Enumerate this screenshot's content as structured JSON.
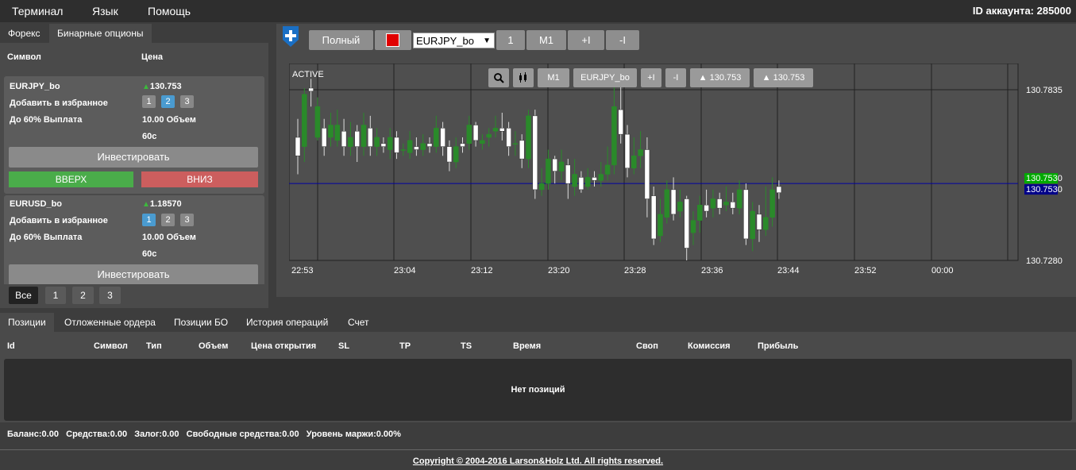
{
  "menu": {
    "terminal": "Терминал",
    "language": "Язык",
    "help": "Помощь",
    "account": "ID аккаунта: 285000"
  },
  "left": {
    "tabs": [
      "Форекс",
      "Бинарные опционы"
    ],
    "col_symbol": "Символ",
    "col_price": "Цена",
    "cards": [
      {
        "symbol": "EURJPY_bo",
        "price": "130.753",
        "fav_label": "Добавить в избранное",
        "fav_selected": 2,
        "payout": "До 60% Выплата",
        "volume": "10.00 Объем",
        "duration": "60с",
        "invest": "Инвестировать",
        "up": "ВВЕРХ",
        "down": "ВНИЗ"
      },
      {
        "symbol": "EURUSD_bo",
        "price": "1.18570",
        "fav_label": "Добавить в избранное",
        "fav_selected": 1,
        "payout": "До 60% Выплата",
        "volume": "10.00 Объем",
        "duration": "60с",
        "invest": "Инвестировать"
      }
    ],
    "fav_nums": [
      "1",
      "2",
      "3"
    ],
    "filters": [
      "Все",
      "1",
      "2",
      "3"
    ]
  },
  "toolbar": {
    "full": "Полный",
    "symbol": "EURJPY_bo",
    "b1": "1",
    "m1": "M1",
    "plus": "+I",
    "minus": "-I",
    "color": "#e00000"
  },
  "chart_toolbar": {
    "tf": "M1",
    "symbol": "EURJPY_bo",
    "plus": "+I",
    "minus": "-I",
    "bid": "130.753",
    "ask": "130.753"
  },
  "chart_data": {
    "type": "candlestick",
    "label": "ACTIVE",
    "x_ticks": [
      "22:53",
      "23:04",
      "23:12",
      "23:20",
      "23:28",
      "23:36",
      "23:44",
      "23:52",
      "00:00"
    ],
    "y_ticks": [
      "130.7835",
      "130.7280"
    ],
    "ylim": [
      130.728,
      130.792
    ],
    "price_tags": [
      {
        "value": "130.7530",
        "color": "#00aa00"
      },
      {
        "value": "130.7530",
        "color": "#000088"
      }
    ],
    "crosshair_y": 130.7835,
    "current_line_y": 130.753,
    "candles": [
      [
        130.768,
        130.762,
        130.774,
        130.756
      ],
      [
        130.765,
        130.782,
        130.784,
        130.76
      ],
      [
        130.784,
        130.783,
        130.787,
        130.778
      ],
      [
        130.768,
        130.778,
        130.781,
        130.767
      ],
      [
        130.771,
        130.765,
        130.774,
        130.762
      ],
      [
        130.768,
        130.772,
        130.776,
        130.765
      ],
      [
        130.767,
        130.772,
        130.777,
        130.765
      ],
      [
        130.77,
        130.765,
        130.774,
        130.762
      ],
      [
        130.765,
        130.768,
        130.773,
        130.762
      ],
      [
        130.77,
        130.765,
        130.772,
        130.76
      ],
      [
        130.765,
        130.772,
        130.776,
        130.762
      ],
      [
        130.771,
        130.765,
        130.775,
        130.762
      ],
      [
        130.765,
        130.768,
        130.771,
        130.762
      ],
      [
        130.766,
        130.765,
        130.768,
        130.763
      ],
      [
        130.764,
        130.768,
        130.771,
        130.761
      ],
      [
        130.768,
        130.763,
        130.77,
        130.761
      ],
      [
        130.764,
        130.764,
        130.766,
        130.762
      ],
      [
        130.763,
        130.767,
        130.77,
        130.761
      ],
      [
        130.765,
        130.764,
        130.768,
        130.762
      ],
      [
        130.764,
        130.766,
        130.769,
        130.762
      ],
      [
        130.766,
        130.765,
        130.768,
        130.763
      ],
      [
        130.765,
        130.771,
        130.775,
        130.763
      ],
      [
        130.771,
        130.765,
        130.773,
        130.762
      ],
      [
        130.765,
        130.76,
        130.767,
        130.757
      ],
      [
        130.76,
        130.765,
        130.768,
        130.758
      ],
      [
        130.766,
        130.765,
        130.768,
        130.763
      ],
      [
        130.766,
        130.772,
        130.775,
        130.764
      ],
      [
        130.772,
        130.767,
        130.773,
        130.765
      ],
      [
        130.766,
        130.767,
        130.769,
        130.764
      ],
      [
        130.768,
        130.769,
        130.771,
        130.765
      ],
      [
        130.77,
        130.771,
        130.775,
        130.768
      ],
      [
        130.771,
        130.77,
        130.776,
        130.767
      ],
      [
        130.771,
        130.765,
        130.773,
        130.762
      ],
      [
        130.766,
        130.766,
        130.77,
        130.762
      ],
      [
        130.767,
        130.761,
        130.769,
        130.758
      ],
      [
        130.761,
        130.775,
        130.777,
        130.758
      ],
      [
        130.775,
        130.751,
        130.777,
        130.748
      ],
      [
        130.751,
        130.753,
        130.758,
        130.749
      ],
      [
        130.753,
        130.761,
        130.764,
        130.751
      ],
      [
        130.761,
        130.757,
        130.762,
        130.753
      ],
      [
        130.757,
        130.76,
        130.764,
        130.754
      ],
      [
        130.759,
        130.753,
        130.761,
        130.748
      ],
      [
        130.752,
        130.756,
        130.761,
        130.749
      ],
      [
        130.755,
        130.751,
        130.757,
        130.75
      ],
      [
        130.752,
        130.755,
        130.758,
        130.751
      ],
      [
        130.755,
        130.754,
        130.757,
        130.752
      ],
      [
        130.754,
        130.756,
        130.76,
        130.752
      ],
      [
        130.756,
        130.759,
        130.765,
        130.754
      ],
      [
        130.759,
        130.778,
        130.785,
        130.756
      ],
      [
        130.777,
        130.769,
        130.785,
        130.766
      ],
      [
        130.769,
        130.758,
        130.772,
        130.755
      ],
      [
        130.758,
        130.762,
        130.768,
        130.756
      ],
      [
        130.762,
        130.764,
        130.77,
        130.758
      ],
      [
        130.764,
        130.748,
        130.768,
        130.742
      ],
      [
        130.749,
        130.735,
        130.752,
        130.733
      ],
      [
        130.736,
        130.743,
        130.748,
        130.734
      ],
      [
        130.742,
        130.751,
        130.754,
        130.74
      ],
      [
        130.751,
        130.743,
        130.755,
        130.741
      ],
      [
        130.744,
        130.747,
        130.751,
        130.742
      ],
      [
        130.748,
        130.732,
        130.749,
        130.728
      ],
      [
        130.737,
        130.741,
        130.744,
        130.733
      ],
      [
        130.741,
        130.746,
        130.749,
        130.737
      ],
      [
        130.746,
        130.744,
        130.751,
        130.742
      ],
      [
        130.745,
        130.748,
        130.751,
        130.742
      ],
      [
        130.748,
        130.745,
        130.75,
        130.743
      ],
      [
        130.746,
        130.747,
        130.752,
        130.744
      ],
      [
        130.747,
        130.745,
        130.75,
        130.743
      ],
      [
        130.745,
        130.751,
        130.754,
        130.743
      ],
      [
        130.751,
        130.735,
        130.753,
        130.733
      ],
      [
        130.735,
        130.744,
        130.747,
        130.731
      ],
      [
        130.743,
        130.738,
        130.746,
        130.734
      ],
      [
        130.738,
        130.742,
        130.752,
        130.736
      ],
      [
        130.742,
        130.751,
        130.755,
        130.739
      ],
      [
        130.752,
        130.75,
        130.754,
        130.748
      ]
    ]
  },
  "bottom": {
    "tabs": [
      "Позиции",
      "Отложенные ордера",
      "Позиции БО",
      "История операций",
      "Счет"
    ],
    "columns": [
      "Id",
      "Символ",
      "Тип",
      "Объем",
      "Цена открытия",
      "SL",
      "TP",
      "TS",
      "Время",
      "Своп",
      "Комиссия",
      "Прибыль"
    ],
    "empty": "Нет позиций",
    "balance": "Баланс:0.00",
    "equity": "Средства:0.00",
    "margin": "Залог:0.00",
    "free": "Свободные средства:0.00",
    "level": "Уровень маржи:0.00%"
  },
  "copyright": "Copyright © 2004-2016 Larson&Holz Ltd. All rights reserved."
}
